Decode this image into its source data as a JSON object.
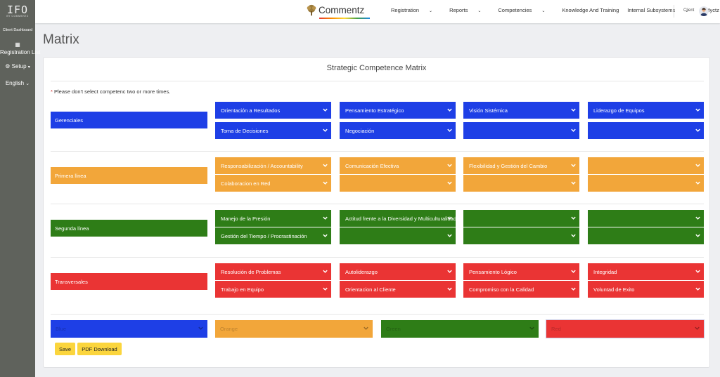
{
  "sidebar": {
    "logo_text": "IFO",
    "logo_sub": "BY COMMENTZ",
    "dashboard_label": "Client Dashboard",
    "registration_label": "Registration List",
    "setup_label": "Setup",
    "language_label": "English"
  },
  "topbar": {
    "brand": "Commentz",
    "nav": [
      "Registration",
      "Reports",
      "Competencies",
      "Knowledge And Training",
      "Internal Subsystems",
      "Myctz"
    ],
    "client_label": "Client"
  },
  "page": {
    "title": "Matrix",
    "card_title": "Strategic Competence Matrix",
    "note": "Please don't select competenc two or more times."
  },
  "colors": {
    "blue": "#1e3fe6",
    "orange": "#f2a63a",
    "green": "#2e7d17",
    "red": "#ea3434"
  },
  "groups": [
    {
      "label": "Gerenciales",
      "color": "#1e3fe6",
      "options": [
        "Orientación a Resultados",
        "Pensamiento Estratégico",
        "Visión Sistémica",
        "Liderazgo de Equipos",
        "Toma de Decisiones",
        "Negociación",
        "",
        ""
      ]
    },
    {
      "label": "Primera línea",
      "color": "#f2a63a",
      "options": [
        "Responsabilización / Accountability",
        "Comunicación Efectiva",
        "Flexibilidad y Gestión del Cambio",
        "",
        "Colaboracion en Red",
        "",
        "",
        ""
      ]
    },
    {
      "label": "Segunda línea",
      "color": "#2e7d17",
      "options": [
        "Manejo de la Presión",
        "Actitud frente a la Diversidad y Multiculturalidad",
        "",
        "",
        "Gestión del Tiempo / Procrastinación",
        "",
        "",
        ""
      ]
    },
    {
      "label": "Transversales",
      "color": "#ea3434",
      "options": [
        "Resolución de Problemas",
        "Autoliderazgo",
        "Pensamiento Lógico",
        "Integridad",
        "Trabajo en Equipo",
        "Orientacion al Cliente",
        "Compromiso con la Calidad",
        "Voluntad de Exito"
      ]
    }
  ],
  "color_pickers": [
    {
      "placeholder": "Blue",
      "color": "#1e3fe6"
    },
    {
      "placeholder": "Orange",
      "color": "#f2a63a"
    },
    {
      "placeholder": "Green",
      "color": "#2e7d17"
    },
    {
      "placeholder": "Red",
      "color": "#ea3434"
    }
  ],
  "buttons": {
    "save": "Save",
    "pdf": "PDF Download"
  }
}
